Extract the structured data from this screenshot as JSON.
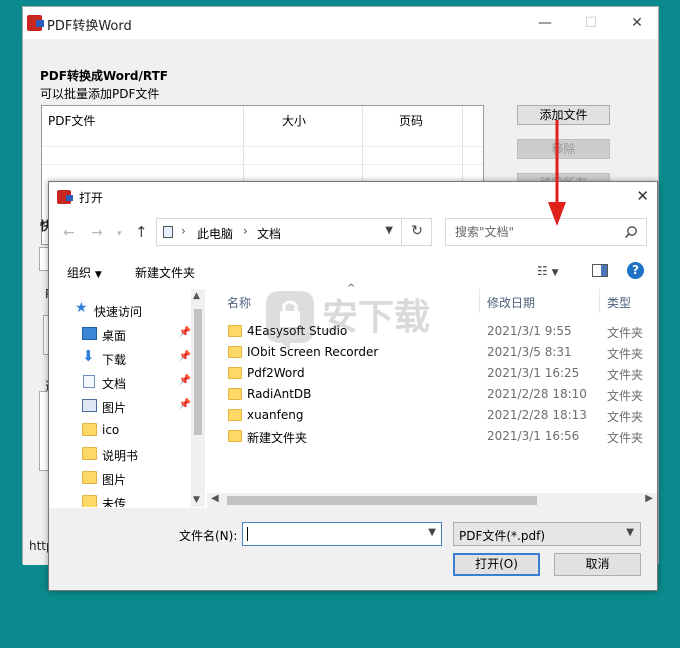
{
  "main_window": {
    "title": "PDF转换Word",
    "controls": {
      "minimize": "—",
      "maximize": "☐",
      "close": "✕"
    },
    "heading": "PDF转换成Word/RTF",
    "subheading": "可以批量添加PDF文件",
    "table_headers": [
      "PDF文件",
      "大小",
      "页码"
    ],
    "buttons": {
      "add_files": "添加文件",
      "remove": "移除",
      "remove_all": "移除所有"
    },
    "peek_label_1": "快",
    "peek_label_2": "P",
    "peek_label_3": "选",
    "status_text": "http"
  },
  "dialog": {
    "title": "打开",
    "close_glyph": "✕",
    "address": {
      "segments": [
        "此电脑",
        "文档"
      ]
    },
    "search": {
      "placeholder": "搜索\"文档\""
    },
    "toolbar": {
      "organize": "组织",
      "new_folder": "新建文件夹"
    },
    "nav_items": [
      {
        "label": "快速访问",
        "icon": "star-icon"
      },
      {
        "label": "桌面",
        "icon": "desktop-icon",
        "pinned": true
      },
      {
        "label": "下载",
        "icon": "download-icon",
        "pinned": true
      },
      {
        "label": "文档",
        "icon": "document-icon",
        "pinned": true
      },
      {
        "label": "图片",
        "icon": "picture-icon",
        "pinned": true
      },
      {
        "label": "ico",
        "icon": "folder-icon"
      },
      {
        "label": "说明书",
        "icon": "folder-icon"
      },
      {
        "label": "图片",
        "icon": "folder-icon"
      },
      {
        "label": "未传",
        "icon": "folder-icon"
      }
    ],
    "columns": {
      "name": "名称",
      "modified": "修改日期",
      "type": "类型"
    },
    "files": [
      {
        "name": "4Easysoft Studio",
        "modified": "2021/3/1 9:55",
        "type": "文件夹"
      },
      {
        "name": "IObit Screen Recorder",
        "modified": "2021/3/5 8:31",
        "type": "文件夹"
      },
      {
        "name": "Pdf2Word",
        "modified": "2021/3/1 16:25",
        "type": "文件夹"
      },
      {
        "name": "RadiAntDB",
        "modified": "2021/2/28 18:10",
        "type": "文件夹"
      },
      {
        "name": "xuanfeng",
        "modified": "2021/2/28 18:13",
        "type": "文件夹"
      },
      {
        "name": "新建文件夹",
        "modified": "2021/3/1 16:56",
        "type": "文件夹"
      }
    ],
    "filename_label": "文件名(N):",
    "filename_value": "",
    "filetype_value": "PDF文件(*.pdf)",
    "open_button": "打开(O)",
    "cancel_button": "取消"
  },
  "watermark_text": "安下载",
  "colors": {
    "desktop": "#0a8a8c",
    "accent_blue": "#1e72c6",
    "folder": "#ffd866",
    "arrow_red": "#e0201b"
  }
}
